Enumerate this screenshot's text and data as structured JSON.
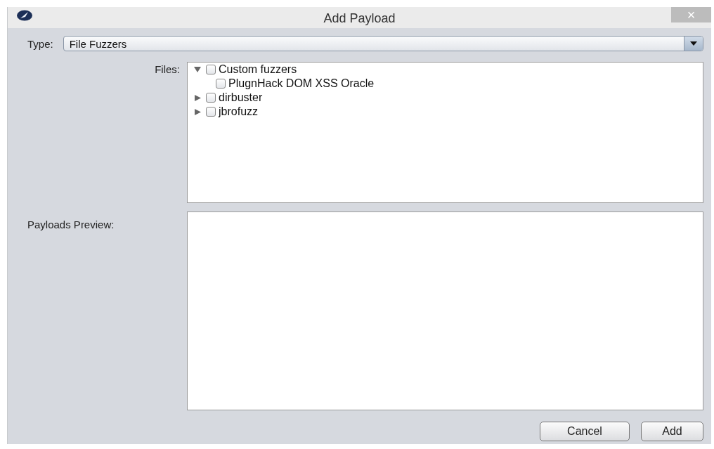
{
  "window": {
    "title": "Add Payload",
    "close": "×"
  },
  "type": {
    "label": "Type:",
    "value": "File Fuzzers"
  },
  "files": {
    "label": "Files:",
    "tree": [
      {
        "label": "Custom fuzzers",
        "checked": false,
        "expanded": true,
        "children": [
          {
            "label": "PlugnHack DOM XSS Oracle",
            "checked": false
          }
        ]
      },
      {
        "label": "dirbuster",
        "checked": false,
        "expanded": false
      },
      {
        "label": "jbrofuzz",
        "checked": false,
        "expanded": false
      }
    ]
  },
  "preview": {
    "label": "Payloads Preview:"
  },
  "buttons": [
    "Cancel",
    "Add"
  ]
}
